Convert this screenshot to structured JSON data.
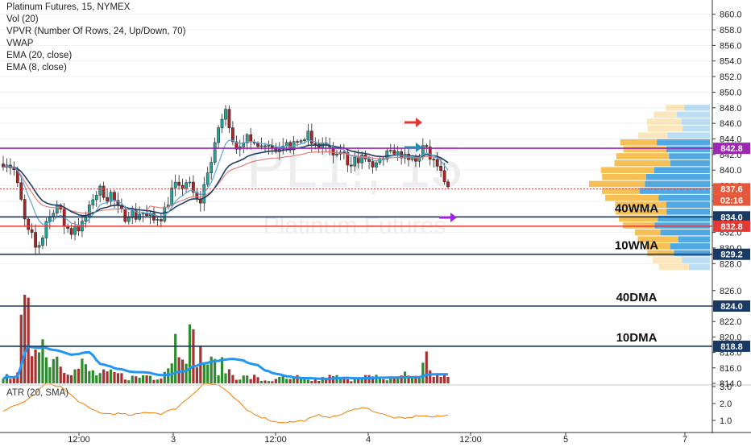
{
  "legend": {
    "symbol": "Platinum Futures, 15, NYMEX",
    "lines": [
      "Vol (20)",
      "VPVR (Number Of Rows, 24, Up/Down, 70)",
      "VWAP",
      "EMA (20, close)",
      "EMA (8, close)"
    ]
  },
  "watermark": {
    "ticker": "PL1!, 15",
    "name": "Platinum Futures"
  },
  "atr_label": "ATR (20, SMA)",
  "colors": {
    "up": "#26a69a",
    "down": "#b22222",
    "ema8": "#5aa6d8",
    "ema20": "#1f3f66",
    "vwap": "#e57373",
    "purple": "#9c27b0",
    "navy": "#1a3a66",
    "red_line": "#e53935",
    "vol_up": "#2e8b2e",
    "vol_down": "#a83232",
    "vol_ma": "#2196f3",
    "vp_up": "#f5b942",
    "vp_down": "#3ea0e0",
    "atr": "#f57c00"
  },
  "chart_data": {
    "type": "candlestick",
    "price_axis": {
      "min": 827,
      "max": 861,
      "ticks": [
        860.0,
        858.0,
        856.0,
        854.0,
        852.0,
        850.0,
        848.0,
        846.0,
        844.0,
        842.0,
        840.0,
        838.0,
        836.0,
        834.0,
        832.0,
        830.0,
        828.0
      ]
    },
    "lower_axis": {
      "ticks": [
        826.0,
        824.0,
        822.0,
        820.0,
        818.0,
        816.0,
        814.0
      ]
    },
    "atr_axis": {
      "ticks": [
        "3.0",
        "2.0",
        "1.0"
      ]
    },
    "time_axis": [
      "12:00",
      "3",
      "12:00",
      "4",
      "12:00",
      "5",
      "7"
    ],
    "last_price": {
      "label": "837.6",
      "countdown": "02:16"
    },
    "horizontal_levels": [
      {
        "label": "842.8",
        "color": "purple"
      },
      {
        "label": "834.0",
        "color": "navy",
        "annotation": "40WMA"
      },
      {
        "label": "832.8",
        "color": "red",
        "annotation": ""
      },
      {
        "label": "829.2",
        "color": "navy",
        "annotation": "10WMA"
      },
      {
        "label": "824.0",
        "color": "navy",
        "annotation": "40DMA"
      },
      {
        "label": "818.8",
        "color": "navy",
        "annotation": "10DMA"
      }
    ],
    "price_path": [
      [
        0,
        841
      ],
      [
        1,
        841
      ],
      [
        2,
        840.5
      ],
      [
        3,
        840
      ],
      [
        4,
        838
      ],
      [
        5,
        836
      ],
      [
        6,
        833.5
      ],
      [
        7,
        832
      ],
      [
        8,
        831.5
      ],
      [
        9,
        830
      ],
      [
        10,
        830.5
      ],
      [
        11,
        831.5
      ],
      [
        12,
        833.5
      ],
      [
        13,
        834
      ],
      [
        14,
        835
      ],
      [
        15,
        835.5
      ],
      [
        16,
        834.5
      ],
      [
        17,
        833
      ],
      [
        18,
        832.5
      ],
      [
        19,
        832
      ],
      [
        20,
        833
      ],
      [
        21,
        832.5
      ],
      [
        22,
        833
      ],
      [
        23,
        834
      ],
      [
        24,
        835
      ],
      [
        25,
        836.5
      ],
      [
        26,
        837
      ],
      [
        27,
        837.5
      ],
      [
        28,
        837
      ],
      [
        29,
        836.5
      ],
      [
        30,
        837
      ],
      [
        31,
        836
      ],
      [
        32,
        835
      ],
      [
        33,
        834.5
      ],
      [
        34,
        834
      ],
      [
        35,
        834.5
      ],
      [
        36,
        834.5
      ],
      [
        37,
        834
      ],
      [
        38,
        834.5
      ],
      [
        39,
        834.5
      ],
      [
        40,
        834
      ],
      [
        41,
        834
      ],
      [
        42,
        833.5
      ],
      [
        43,
        834
      ],
      [
        44,
        834
      ],
      [
        45,
        835
      ],
      [
        46,
        836
      ],
      [
        47,
        837.5
      ],
      [
        48,
        838
      ],
      [
        49,
        837.5
      ],
      [
        50,
        838
      ],
      [
        51,
        838.5
      ],
      [
        52,
        838
      ],
      [
        53,
        837
      ],
      [
        54,
        836
      ],
      [
        55,
        836
      ],
      [
        56,
        838
      ],
      [
        57,
        840
      ],
      [
        58,
        841
      ],
      [
        59,
        843
      ],
      [
        60,
        845.5
      ],
      [
        61,
        846.5
      ],
      [
        62,
        847.5
      ],
      [
        63,
        846
      ],
      [
        64,
        844
      ],
      [
        65,
        843
      ],
      [
        66,
        843.5
      ],
      [
        67,
        843
      ],
      [
        68,
        844
      ],
      [
        69,
        843.5
      ],
      [
        70,
        844
      ],
      [
        71,
        843.5
      ],
      [
        72,
        843
      ],
      [
        73,
        843.5
      ],
      [
        74,
        843.5
      ],
      [
        75,
        843
      ],
      [
        76,
        842.5
      ],
      [
        77,
        843
      ],
      [
        78,
        843.5
      ],
      [
        79,
        844
      ],
      [
        80,
        843
      ],
      [
        81,
        843.5
      ],
      [
        82,
        843
      ],
      [
        83,
        844
      ],
      [
        84,
        844
      ],
      [
        85,
        844.5
      ],
      [
        86,
        843.5
      ],
      [
        87,
        843
      ],
      [
        88,
        843
      ],
      [
        89,
        843.5
      ],
      [
        90,
        843
      ],
      [
        91,
        842.5
      ],
      [
        92,
        842
      ],
      [
        93,
        841.5
      ],
      [
        94,
        842.5
      ],
      [
        95,
        842
      ],
      [
        96,
        841
      ],
      [
        97,
        841
      ],
      [
        98,
        841.5
      ],
      [
        99,
        841
      ],
      [
        100,
        841.5
      ],
      [
        101,
        841.5
      ],
      [
        102,
        841
      ],
      [
        103,
        840
      ],
      [
        104,
        840.5
      ],
      [
        105,
        841
      ],
      [
        106,
        841.5
      ],
      [
        107,
        842
      ],
      [
        108,
        842
      ],
      [
        109,
        842.5
      ],
      [
        110,
        842
      ],
      [
        111,
        842
      ],
      [
        112,
        841.5
      ],
      [
        113,
        841
      ],
      [
        114,
        841.5
      ],
      [
        115,
        841
      ],
      [
        116,
        842
      ],
      [
        117,
        843
      ],
      [
        118,
        842.5
      ],
      [
        119,
        841.5
      ],
      [
        120,
        841
      ],
      [
        121,
        840.5
      ],
      [
        122,
        839.5
      ],
      [
        123,
        838
      ],
      [
        124,
        837.6
      ]
    ],
    "volume_path": [
      [
        0,
        1
      ],
      [
        2,
        3
      ],
      [
        4,
        5
      ],
      [
        6,
        25
      ],
      [
        8,
        12
      ],
      [
        10,
        22
      ],
      [
        12,
        8
      ],
      [
        14,
        10
      ],
      [
        16,
        8
      ],
      [
        18,
        6
      ],
      [
        20,
        4
      ],
      [
        22,
        6
      ],
      [
        24,
        4
      ],
      [
        26,
        3
      ],
      [
        28,
        3
      ],
      [
        30,
        3
      ],
      [
        32,
        3
      ],
      [
        34,
        2
      ],
      [
        36,
        2
      ],
      [
        38,
        2
      ],
      [
        40,
        3
      ],
      [
        42,
        2
      ],
      [
        44,
        3
      ],
      [
        46,
        6
      ],
      [
        48,
        14
      ],
      [
        50,
        16
      ],
      [
        52,
        14
      ],
      [
        54,
        11
      ],
      [
        56,
        8
      ],
      [
        58,
        6
      ],
      [
        60,
        6
      ],
      [
        62,
        5
      ],
      [
        64,
        3
      ],
      [
        66,
        2
      ],
      [
        68,
        2
      ],
      [
        70,
        2
      ],
      [
        72,
        1
      ],
      [
        74,
        1
      ],
      [
        76,
        1
      ],
      [
        78,
        2
      ],
      [
        80,
        1
      ],
      [
        82,
        2
      ],
      [
        84,
        1
      ],
      [
        86,
        1
      ],
      [
        88,
        1
      ],
      [
        90,
        2
      ],
      [
        92,
        2
      ],
      [
        94,
        2
      ],
      [
        96,
        1
      ],
      [
        98,
        2
      ],
      [
        100,
        3
      ],
      [
        102,
        2
      ],
      [
        104,
        2
      ],
      [
        106,
        1
      ],
      [
        108,
        2
      ],
      [
        110,
        2
      ],
      [
        112,
        3
      ],
      [
        114,
        2
      ],
      [
        116,
        3
      ],
      [
        118,
        8
      ],
      [
        120,
        3
      ],
      [
        122,
        2
      ],
      [
        124,
        2
      ]
    ],
    "atr_path": [
      [
        0,
        1.6
      ],
      [
        4,
        1.9
      ],
      [
        8,
        2.4
      ],
      [
        12,
        3.2
      ],
      [
        16,
        3.0
      ],
      [
        20,
        2.3
      ],
      [
        24,
        1.7
      ],
      [
        28,
        1.4
      ],
      [
        32,
        1.4
      ],
      [
        36,
        1.3
      ],
      [
        40,
        1.5
      ],
      [
        44,
        1.4
      ],
      [
        48,
        1.7
      ],
      [
        52,
        2.4
      ],
      [
        56,
        3.2
      ],
      [
        60,
        3.1
      ],
      [
        64,
        2.4
      ],
      [
        68,
        1.6
      ],
      [
        72,
        1.2
      ],
      [
        76,
        0.9
      ],
      [
        80,
        0.9
      ],
      [
        84,
        1.0
      ],
      [
        88,
        1.3
      ],
      [
        92,
        1.2
      ],
      [
        96,
        1.5
      ],
      [
        100,
        1.8
      ],
      [
        104,
        1.5
      ],
      [
        108,
        1.2
      ],
      [
        112,
        1.1
      ],
      [
        116,
        1.3
      ],
      [
        120,
        1.2
      ],
      [
        124,
        1.3
      ]
    ]
  }
}
